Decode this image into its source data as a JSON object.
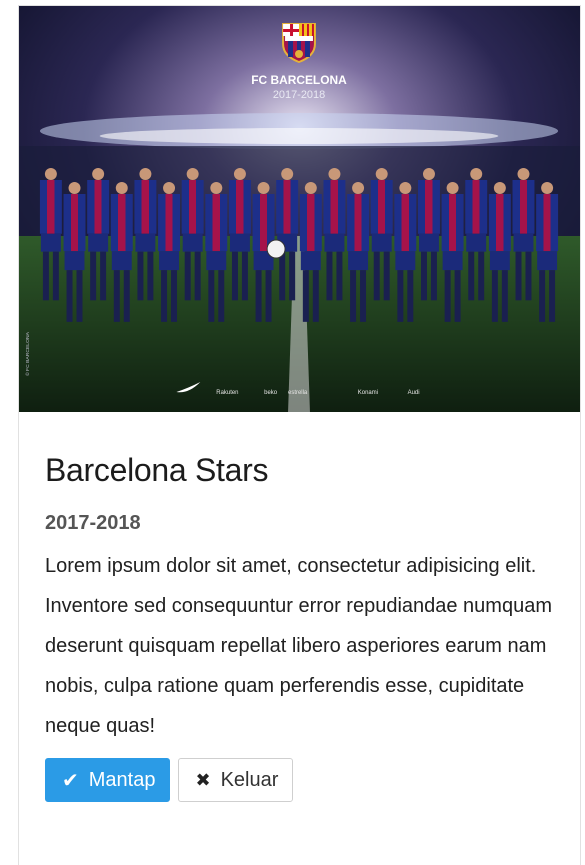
{
  "card": {
    "image": {
      "alt_icon": "team-photo-image",
      "logo_icon": "fc-barcelona-crest-icon",
      "headline": "FC BARCELONA",
      "season": "2017-2018",
      "watermark": "© FC BARCELONA",
      "sponsors": [
        "Rakuten",
        "beko",
        "estrella",
        "Konami",
        "Audi"
      ]
    },
    "title": "Barcelona Stars",
    "subtitle": "2017-2018",
    "text": "Lorem ipsum dolor sit amet, consectetur adipisicing elit. Inventore sed consequuntur error repudiandae numquam deserunt quisquam repellat libero asperiores earum nam nobis, culpa ratione quam perferendis esse, cupiditate neque quas!",
    "buttons": {
      "ok": {
        "label": "Mantap",
        "icon": "check-icon",
        "glyph": "✔"
      },
      "cancel": {
        "label": "Keluar",
        "icon": "close-icon",
        "glyph": "✖"
      }
    }
  },
  "colors": {
    "primary": "#2b9be6",
    "title": "#1c1c1c",
    "subtitle": "#555555",
    "text": "#212121"
  }
}
